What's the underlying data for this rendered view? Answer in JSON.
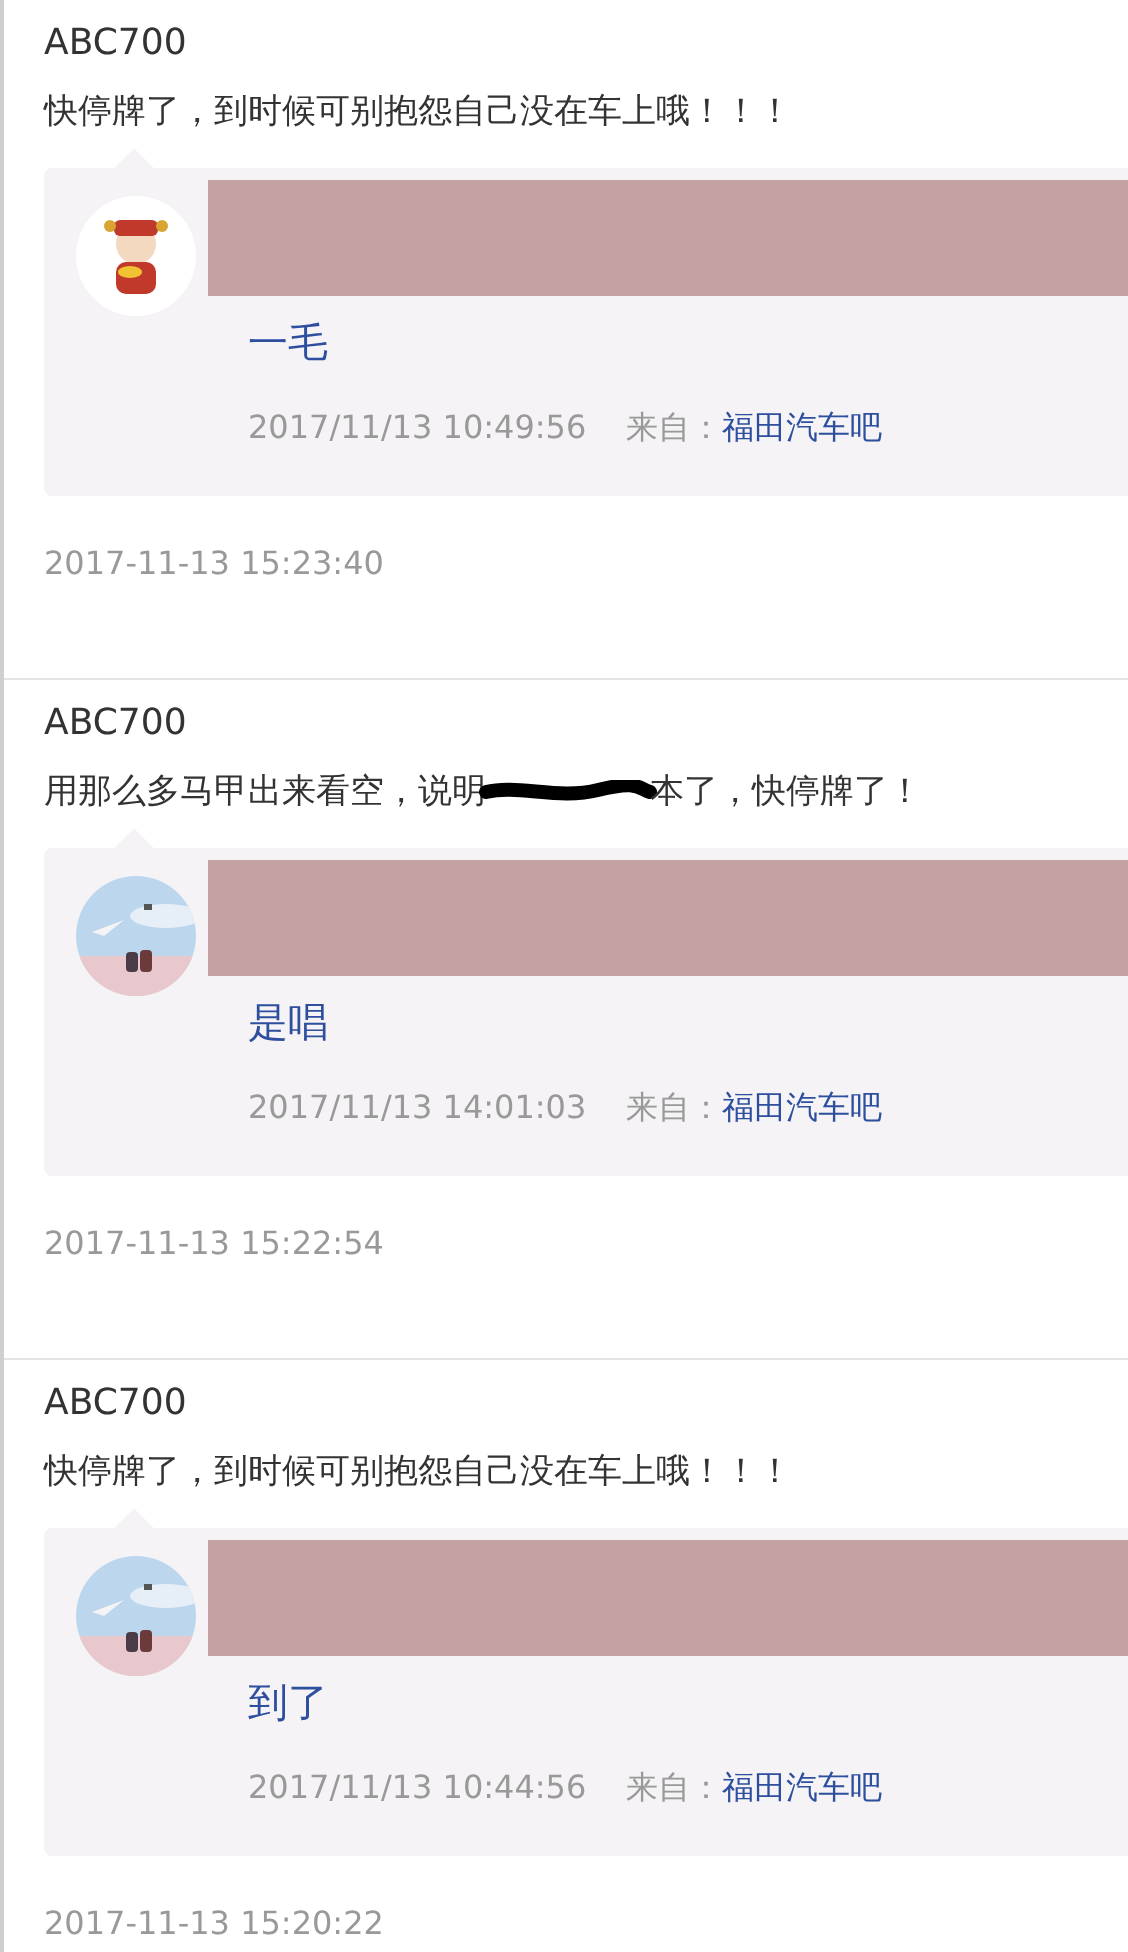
{
  "posts": [
    {
      "user": "ABC700",
      "content": [
        {
          "kind": "text",
          "text": "快停牌了，到时候可别抱怨自己没在车上哦！！！"
        }
      ],
      "quote": {
        "kind": "cartoon",
        "visible_text": "一毛",
        "time": "2017/11/13 10:49:56",
        "from_label": "来自：",
        "forum": "福田汽车吧"
      },
      "time": "2017-11-13 15:23:40"
    },
    {
      "user": "ABC700",
      "content": [
        {
          "kind": "text",
          "text": "用那么多马甲出来看空，说明"
        },
        {
          "kind": "scribble"
        },
        {
          "kind": "text",
          "text": "本了，快停牌了！"
        }
      ],
      "quote": {
        "kind": "scenery",
        "visible_text": "是唱",
        "time": "2017/11/13 14:01:03",
        "from_label": "来自：",
        "forum": "福田汽车吧"
      },
      "time": "2017-11-13 15:22:54"
    },
    {
      "user": "ABC700",
      "content": [
        {
          "kind": "text",
          "text": "快停牌了，到时候可别抱怨自己没在车上哦！！！"
        }
      ],
      "quote": {
        "kind": "scenery",
        "visible_text": "到了",
        "time": "2017/11/13 10:44:56",
        "from_label": "来自：",
        "forum": "福田汽车吧"
      },
      "time": "2017-11-13 15:20:22"
    }
  ]
}
